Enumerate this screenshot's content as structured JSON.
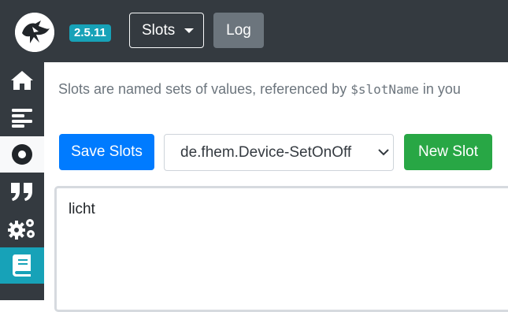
{
  "header": {
    "version": "2.5.11",
    "slots_label": "Slots",
    "log_label": "Log"
  },
  "sidebar": {
    "items": [
      {
        "icon": "home-icon"
      },
      {
        "icon": "align-left-icon"
      },
      {
        "icon": "dot-circle-icon"
      },
      {
        "icon": "quote-icon"
      },
      {
        "icon": "cogs-icon"
      },
      {
        "icon": "book-icon"
      }
    ]
  },
  "main": {
    "intro_before": "Slots are named sets of values, referenced by ",
    "intro_code": "$slotName",
    "intro_after": " in you",
    "save_label": "Save Slots",
    "selected_slot": "de.fhem.Device-SetOnOff",
    "new_label": "New Slot",
    "editor_value": "licht"
  },
  "colors": {
    "navbar": "#343a40",
    "badge": "#17a2b8",
    "primary": "#007bff",
    "success": "#28a745",
    "secondary": "#6c757d"
  }
}
